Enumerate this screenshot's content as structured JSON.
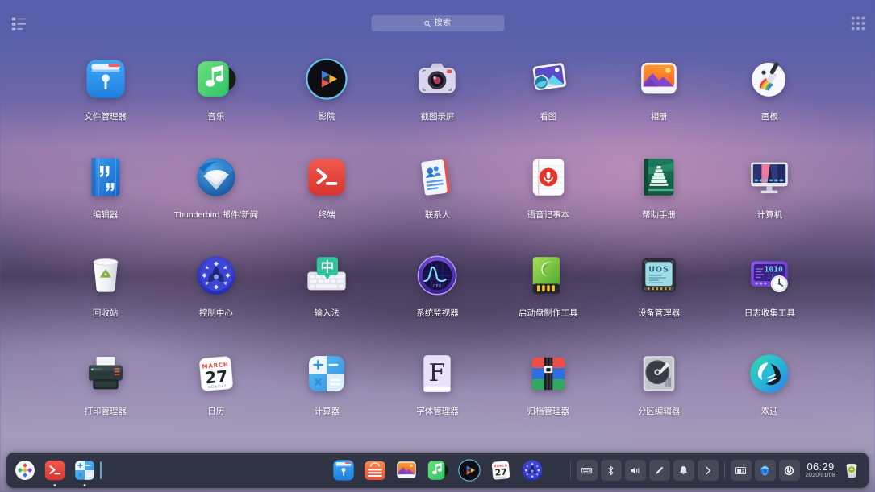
{
  "desktop": {
    "name": "UOS Launcher Fullscreen",
    "accent": "#5f66b3",
    "dock_bg": "#262a3a"
  },
  "topbar": {
    "view_toggle_left": "list-view-icon",
    "view_toggle_right": "category-view-icon",
    "search": {
      "placeholder": "搜索",
      "value": "",
      "icon": "search-icon"
    }
  },
  "apps": [
    {
      "label": "文件管理器",
      "icon": "file-manager-icon"
    },
    {
      "label": "音乐",
      "icon": "music-icon"
    },
    {
      "label": "影院",
      "icon": "movie-icon"
    },
    {
      "label": "截图录屏",
      "icon": "screen-capture-icon"
    },
    {
      "label": "看图",
      "icon": "image-viewer-icon"
    },
    {
      "label": "相册",
      "icon": "album-icon"
    },
    {
      "label": "画板",
      "icon": "drawing-icon"
    },
    {
      "label": "编辑器",
      "icon": "text-editor-icon"
    },
    {
      "label": "Thunderbird 邮件/新闻",
      "icon": "thunderbird-icon"
    },
    {
      "label": "终端",
      "icon": "terminal-icon"
    },
    {
      "label": "联系人",
      "icon": "contacts-icon"
    },
    {
      "label": "语音记事本",
      "icon": "voice-note-icon"
    },
    {
      "label": "帮助手册",
      "icon": "help-manual-icon"
    },
    {
      "label": "计算机",
      "icon": "computer-icon"
    },
    {
      "label": "回收站",
      "icon": "trash-icon"
    },
    {
      "label": "控制中心",
      "icon": "control-center-icon"
    },
    {
      "label": "输入法",
      "icon": "input-method-icon"
    },
    {
      "label": "系统监视器",
      "icon": "system-monitor-icon"
    },
    {
      "label": "启动盘制作工具",
      "icon": "boot-maker-icon"
    },
    {
      "label": "设备管理器",
      "icon": "device-manager-icon"
    },
    {
      "label": "日志收集工具",
      "icon": "log-collector-icon"
    },
    {
      "label": "打印管理器",
      "icon": "printer-icon"
    },
    {
      "label": "日历",
      "icon": "calendar-icon"
    },
    {
      "label": "计算器",
      "icon": "calculator-icon"
    },
    {
      "label": "字体管理器",
      "icon": "font-manager-icon"
    },
    {
      "label": "归档管理器",
      "icon": "archive-manager-icon"
    },
    {
      "label": "分区编辑器",
      "icon": "partition-editor-icon"
    },
    {
      "label": "欢迎",
      "icon": "welcome-icon"
    }
  ],
  "calendar_icon_text": {
    "month": "MARCH",
    "day": "27",
    "weekday": "MONDAY"
  },
  "device_manager_icon_text": "UOS",
  "font_manager_icon_text": "F",
  "input_method_icon_text": "中",
  "log_collector_icon_text": "1010",
  "dock": {
    "left": [
      {
        "name": "launcher-button",
        "icon": "launcher-icon"
      },
      {
        "name": "dock-terminal",
        "icon": "terminal-icon"
      },
      {
        "name": "dock-calculator",
        "icon": "calculator-icon"
      }
    ],
    "center": [
      {
        "name": "dock-file-manager",
        "icon": "file-manager-icon"
      },
      {
        "name": "dock-app-store",
        "icon": "app-store-icon"
      },
      {
        "name": "dock-album",
        "icon": "album-icon"
      },
      {
        "name": "dock-music",
        "icon": "music-icon"
      },
      {
        "name": "dock-movie",
        "icon": "movie-icon"
      },
      {
        "name": "dock-calendar",
        "icon": "calendar-icon"
      },
      {
        "name": "dock-control-center",
        "icon": "control-center-icon"
      }
    ],
    "tray": [
      {
        "name": "tray-onboard-keyboard",
        "icon": "keyboard-icon"
      },
      {
        "name": "tray-bluetooth",
        "icon": "bluetooth-icon"
      },
      {
        "name": "tray-volume",
        "icon": "volume-icon"
      },
      {
        "name": "tray-brightness",
        "icon": "brightness-pen-icon"
      },
      {
        "name": "tray-notifications",
        "icon": "bell-icon"
      },
      {
        "name": "tray-expand",
        "icon": "chevron-right-icon"
      }
    ],
    "tray_plain": [
      {
        "name": "tray-multitasking-view",
        "icon": "multitask-view-icon"
      },
      {
        "name": "tray-network",
        "icon": "network-globe-icon"
      },
      {
        "name": "tray-power",
        "icon": "power-icon"
      }
    ],
    "clock": {
      "time": "06:29",
      "date": "2020/01/08"
    },
    "trash": {
      "name": "tray-trash",
      "icon": "trash-icon"
    }
  }
}
